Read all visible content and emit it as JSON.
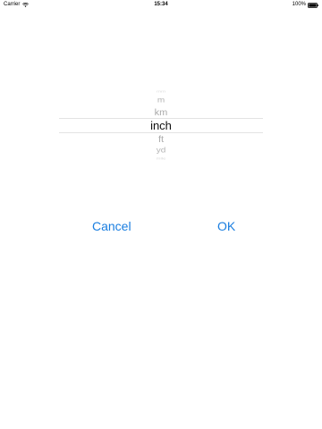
{
  "status_bar": {
    "carrier": "Carrier",
    "time": "15:34",
    "battery_percent": "100%",
    "battery_level": 1.0
  },
  "picker": {
    "rows": [
      "mm",
      "m",
      "km",
      "inch",
      "ft",
      "yd",
      "mile"
    ],
    "selected": "inch"
  },
  "buttons": {
    "cancel_label": "Cancel",
    "ok_label": "OK"
  },
  "colors": {
    "accent": "#1a7ee0",
    "background": "#ffffff"
  }
}
